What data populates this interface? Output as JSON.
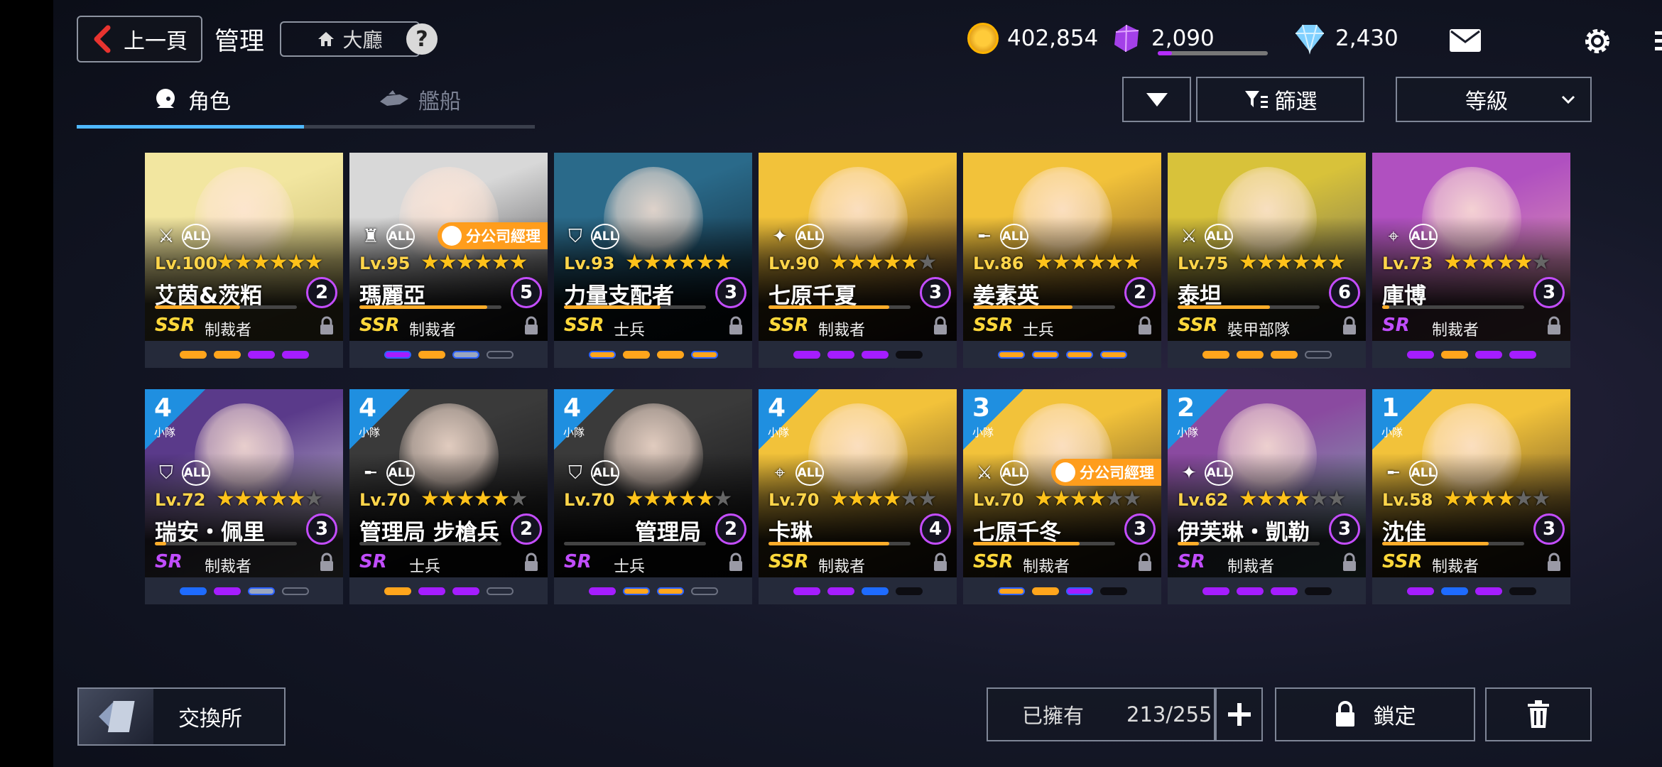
{
  "header": {
    "back_label": "上一頁",
    "title": "管理",
    "lobby_label": "大廳",
    "help_label": "?",
    "gold": "402,854",
    "gems": "2,090",
    "diamonds": "2,430"
  },
  "tabs": [
    {
      "label": "角色",
      "active": true
    },
    {
      "label": "艦船",
      "active": false
    }
  ],
  "controls": {
    "filter_label": "篩選",
    "sort_label": "等級"
  },
  "characters": [
    {
      "name": "艾茵&茨粨",
      "level": "Lv.100",
      "stars": 6,
      "badge": "2",
      "rarity": "SSR",
      "class": "制裁者",
      "xp": 0.6,
      "roles": [
        "swords-icon",
        "all-icon"
      ],
      "pips": [
        "o",
        "o",
        "p",
        "p"
      ],
      "bg": [
        "#f2e6a0",
        "#b8a85a"
      ]
    },
    {
      "name": "瑪麗亞",
      "level": "Lv.95",
      "stars": 6,
      "badge": "5",
      "rarity": "SSR",
      "class": "制裁者",
      "xp": 0.9,
      "roles": [
        "rook-icon",
        "all-icon"
      ],
      "pips": [
        "pp",
        "o",
        "s",
        "e"
      ],
      "manager": "分公司經理",
      "bg": [
        "#d8d8d8",
        "#2a2a2e"
      ]
    },
    {
      "name": "力量支配者",
      "level": "Lv.93",
      "stars": 6,
      "badge": "3",
      "rarity": "SSR",
      "class": "士兵",
      "xp": 0.68,
      "roles": [
        "shield-icon",
        "all-icon"
      ],
      "pips": [
        "oo",
        "o",
        "o",
        "oo"
      ],
      "bg": [
        "#2a6a8a",
        "#0a1a26"
      ]
    },
    {
      "name": "七原千夏",
      "level": "Lv.90",
      "stars": 5,
      "badge": "3",
      "rarity": "SSR",
      "class": "制裁者",
      "xp": 0.85,
      "roles": [
        "sparkle-icon",
        "all-icon"
      ],
      "pips": [
        "p",
        "p",
        "p",
        "k"
      ],
      "bg": [
        "#f2c23a",
        "#3a2020"
      ]
    },
    {
      "name": "姜素英",
      "level": "Lv.86",
      "stars": 6,
      "badge": "2",
      "rarity": "SSR",
      "class": "士兵",
      "xp": 0.7,
      "roles": [
        "rifle-icon",
        "all-icon"
      ],
      "pips": [
        "oo",
        "oo",
        "oo",
        "oo"
      ],
      "bg": [
        "#f2c23a",
        "#5a3a20"
      ]
    },
    {
      "name": "泰坦",
      "level": "Lv.75",
      "stars": 6,
      "badge": "6",
      "rarity": "SSR",
      "class": "裝甲部隊",
      "xp": 0.65,
      "roles": [
        "swords-icon",
        "all-icon"
      ],
      "pips": [
        "o",
        "o",
        "o",
        "e"
      ],
      "bg": [
        "#d8c23a",
        "#5a5a5a"
      ]
    },
    {
      "name": "庫博",
      "level": "Lv.73",
      "stars": 5,
      "badge": "3",
      "rarity": "SR",
      "class": "制裁者",
      "xp": 0.05,
      "roles": [
        "target-icon",
        "all-icon"
      ],
      "pips": [
        "p",
        "o",
        "p",
        "p"
      ],
      "bg": [
        "#b050c0",
        "#f0b0b0"
      ]
    },
    {
      "name": "瑞安・佩里",
      "level": "Lv.72",
      "stars": 5,
      "badge": "3",
      "rarity": "SR",
      "class": "制裁者",
      "xp": 0.08,
      "squad": "4",
      "roles": [
        "shield-icon",
        "all-icon"
      ],
      "pips": [
        "b",
        "p",
        "s",
        "e"
      ],
      "bg": [
        "#5a3a8a",
        "#e8e8e8"
      ]
    },
    {
      "name": "管理局 步槍兵",
      "level": "Lv.70",
      "stars": 5,
      "badge": "2",
      "rarity": "SR",
      "class": "士兵",
      "xp": 0.0,
      "squad": "4",
      "roles": [
        "rifle-icon",
        "all-icon"
      ],
      "pips": [
        "o",
        "p",
        "p",
        "e"
      ],
      "bg": [
        "#3a3a3a",
        "#0e0e10"
      ]
    },
    {
      "name": "管理局",
      "level": "Lv.70",
      "stars": 5,
      "badge": "2",
      "rarity": "SR",
      "class": "士兵",
      "xp": 0.0,
      "squad": "4",
      "roles": [
        "shield-icon",
        "all-icon"
      ],
      "pips": [
        "p",
        "oo",
        "oo",
        "e"
      ],
      "right": true,
      "bg": [
        "#3a3a3a",
        "#0e0e10"
      ]
    },
    {
      "name": "卡琳",
      "level": "Lv.70",
      "stars": 4,
      "badge": "4",
      "rarity": "SSR",
      "class": "制裁者",
      "xp": 0.85,
      "squad": "4",
      "roles": [
        "target-icon",
        "all-icon"
      ],
      "pips": [
        "p",
        "p",
        "b",
        "k"
      ],
      "bg": [
        "#f2c23a",
        "#3a2a20"
      ]
    },
    {
      "name": "七原千冬",
      "level": "Lv.70",
      "stars": 4,
      "badge": "3",
      "rarity": "SSR",
      "class": "制裁者",
      "xp": 0.75,
      "squad": "3",
      "roles": [
        "swords-icon",
        "all-icon"
      ],
      "pips": [
        "oo",
        "o",
        "pp",
        "k"
      ],
      "manager": "分公司經理",
      "bg": [
        "#f2c23a",
        "#3a2a20"
      ]
    },
    {
      "name": "伊芙琳・凱勒",
      "level": "Lv.62",
      "stars": 4,
      "badge": "3",
      "rarity": "SR",
      "class": "制裁者",
      "xp": 0.15,
      "squad": "2",
      "roles": [
        "sparkle-icon",
        "all-icon"
      ],
      "pips": [
        "p",
        "p",
        "p",
        "k"
      ],
      "bg": [
        "#8a4aa0",
        "#80c0b0"
      ]
    },
    {
      "name": "沈佳",
      "level": "Lv.58",
      "stars": 4,
      "badge": "3",
      "rarity": "SSR",
      "class": "制裁者",
      "xp": 0.75,
      "squad": "1",
      "roles": [
        "rifle-icon",
        "all-icon"
      ],
      "pips": [
        "p",
        "b",
        "p",
        "k"
      ],
      "bg": [
        "#f2c23a",
        "#3a2a20"
      ]
    }
  ],
  "squad_label": "小隊",
  "footer": {
    "exchange_label": "交換所",
    "owned_label": "已擁有",
    "owned_value": "213/255",
    "lock_label": "鎖定"
  },
  "colors": {
    "accent": "#4fb8ff",
    "ssr": "#ffd83a",
    "sr": "#c14dff",
    "star": "#ffc21a",
    "level_badge": "#c44dff"
  }
}
